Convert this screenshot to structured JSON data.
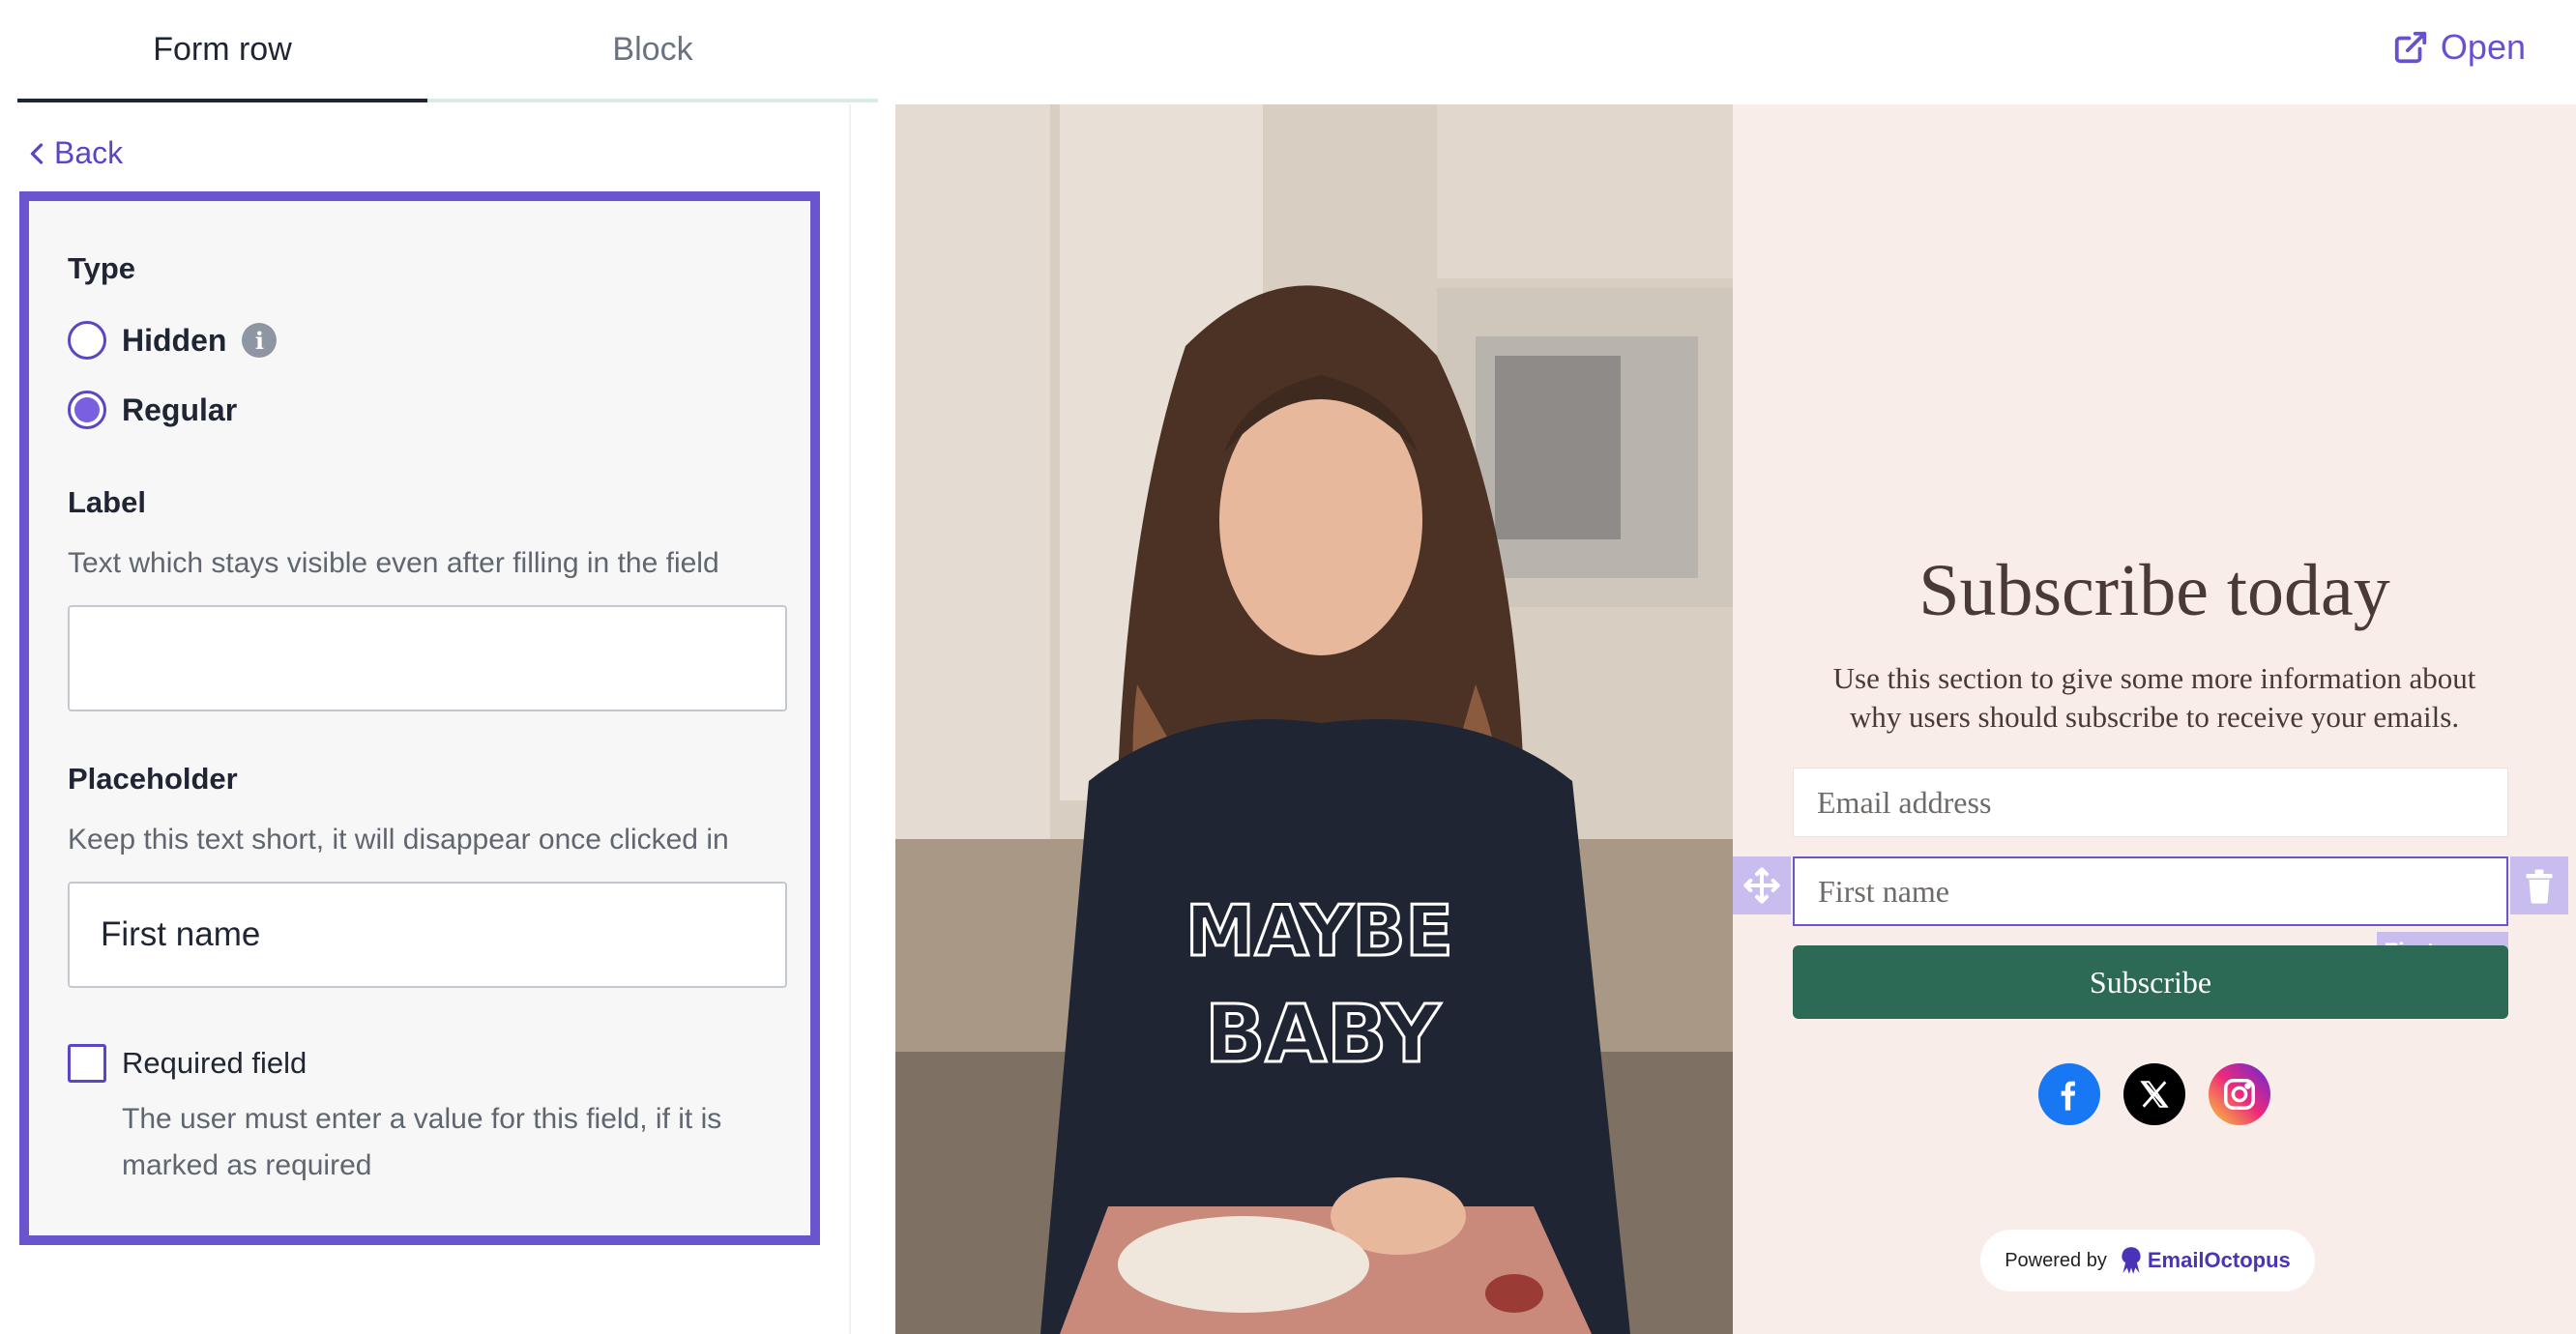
{
  "tabs": {
    "form_row": "Form row",
    "block": "Block"
  },
  "open_label": "Open",
  "back_label": "Back",
  "panel": {
    "type_title": "Type",
    "hidden_label": "Hidden",
    "regular_label": "Regular",
    "selected_type": "Regular",
    "label_title": "Label",
    "label_help": "Text which stays visible even after filling in the field",
    "label_value": "",
    "placeholder_title": "Placeholder",
    "placeholder_help": "Keep this text short, it will disappear once clicked in",
    "placeholder_value": "First name",
    "required_label": "Required field",
    "required_checked": false,
    "required_help": "The user must enter a value for this field, if it is marked as required"
  },
  "preview": {
    "title": "Subscribe today",
    "description": "Use this section to give some more information about why users should subscribe to receive your emails.",
    "email_placeholder": "Email address",
    "first_name_placeholder": "First name",
    "first_name_tag": "First name",
    "subscribe_button": "Subscribe",
    "socials": [
      "facebook-icon",
      "x-icon",
      "instagram-icon"
    ],
    "powered_by": "Powered by",
    "brand": "EmailOctopus"
  },
  "colors": {
    "accent": "#6a55cf",
    "button": "#2d6a55",
    "form_bg": "#f8ede8"
  }
}
